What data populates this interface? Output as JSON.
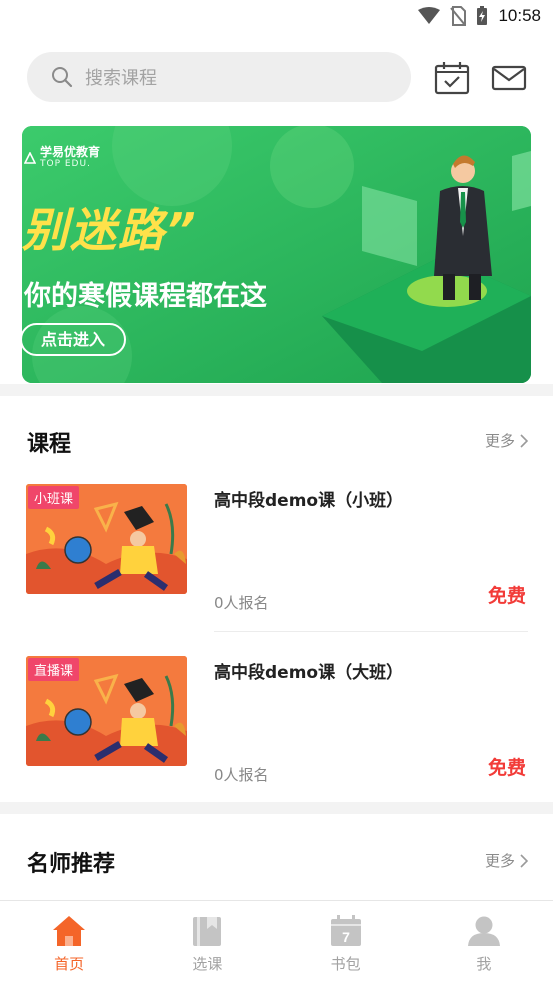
{
  "status": {
    "time": "10:58"
  },
  "search": {
    "placeholder": "搜索课程"
  },
  "banner": {
    "brand": "学易优教育",
    "brand_en": "TOP EDU.",
    "headline": "别迷路”",
    "subline": "你的寒假课程都在这",
    "cta": "点击进入"
  },
  "courses": {
    "title": "课程",
    "more": "更多",
    "items": [
      {
        "tag": "小班课",
        "title": "高中段demo课（小班）",
        "enrolled": "0人报名",
        "price": "免费"
      },
      {
        "tag": "直播课",
        "title": "高中段demo课（大班）",
        "enrolled": "0人报名",
        "price": "免费"
      }
    ]
  },
  "teachers": {
    "title": "名师推荐",
    "more": "更多"
  },
  "tabbar": {
    "items": [
      {
        "label": "首页"
      },
      {
        "label": "选课"
      },
      {
        "label": "书包",
        "badge": "7"
      },
      {
        "label": "我"
      }
    ]
  },
  "colors": {
    "accent": "#f46529",
    "price": "#f23b38",
    "banner": "#29b65a"
  }
}
